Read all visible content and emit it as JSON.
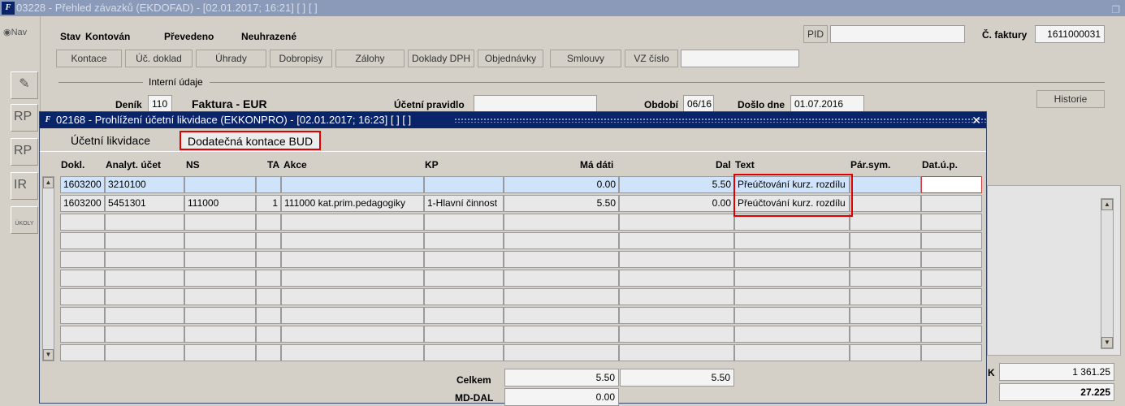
{
  "window": {
    "title": "03228 - Přehled závazků (EKDOFAD) - [02.01.2017; 16:21]  [ ]  [ ]",
    "restore_icon": "restore-icon"
  },
  "nav": {
    "label": "Nav"
  },
  "tools": [
    "RP",
    "RP",
    "IR",
    "ÚKOLY"
  ],
  "status": {
    "stav_label": "Stav",
    "stav_value": "Kontován",
    "prevedeno": "Převedeno",
    "neuhrazene": "Neuhrazené"
  },
  "pid": {
    "label": "PID",
    "value": ""
  },
  "faktura": {
    "label": "Č. faktury",
    "value": "1611000031"
  },
  "buttons": [
    "Kontace",
    "Úč. doklad",
    "Úhrady",
    "Dobropisy",
    "Zálohy",
    "Doklady DPH",
    "Objednávky",
    "Smlouvy",
    "VZ číslo"
  ],
  "interni": {
    "label": "Interní údaje"
  },
  "denik": {
    "label": "Deník",
    "value": "110",
    "type": "Faktura - EUR"
  },
  "ucetni_pravidlo": {
    "label": "Účetní pravidlo",
    "value": ""
  },
  "obdobi": {
    "label": "Období",
    "value": "06/16"
  },
  "doslo": {
    "label": "Došlo dne",
    "value": "01.07.2016"
  },
  "historie": "Historie",
  "bottom_right": {
    "partial_label": "K",
    "value1": "1 361.25",
    "value2": "27.225"
  },
  "modal": {
    "title": "02168 - Prohlížení účetní likvidace (EKKONPRO) - [02.01.2017; 16:23]  [ ]  [ ]",
    "tabs": [
      "Účetní likvidace",
      "Dodatečná kontace BUD"
    ],
    "columns": [
      "Dokl.",
      "Analyt. účet",
      "NS",
      "TA",
      "Akce",
      "KP",
      "Má dáti",
      "Dal",
      "Text",
      "Pár.sym.",
      "Dat.ú.p."
    ],
    "rows": [
      {
        "dokl": "1603200",
        "ucet": "3210100",
        "ns": "",
        "ta": "",
        "akce": "",
        "kp": "",
        "md": "0.00",
        "dal": "5.50",
        "text": "Přeúčtování kurz. rozdílu",
        "par": "",
        "dat": ""
      },
      {
        "dokl": "1603200",
        "ucet": "5451301",
        "ns": "111000",
        "ta": "1",
        "akce": "111000 kat.prim.pedagogiky",
        "kp": "1-Hlavní činnost",
        "md": "5.50",
        "dal": "0.00",
        "text": "Přeúčtování kurz. rozdílu",
        "par": "",
        "dat": ""
      }
    ],
    "celkem": {
      "label": "Celkem",
      "md": "5.50",
      "dal": "5.50"
    },
    "mddal": {
      "label": "MD-DAL",
      "value": "0.00"
    }
  }
}
